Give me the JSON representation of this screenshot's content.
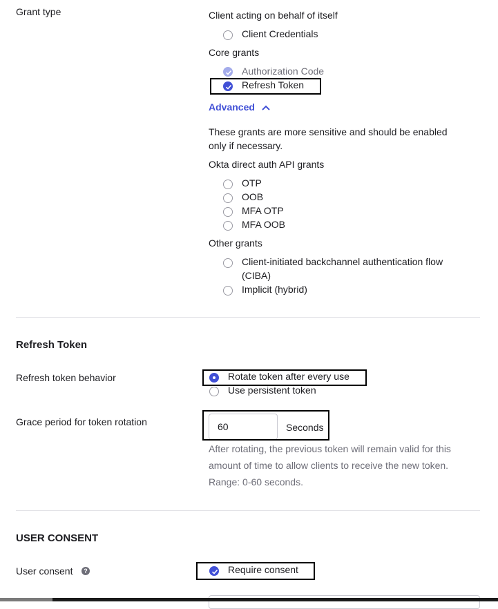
{
  "grant_type": {
    "label": "Grant type",
    "self_group": "Client acting on behalf of itself",
    "client_credentials": "Client Credentials",
    "core_group": "Core grants",
    "authorization_code": "Authorization Code",
    "refresh_token": "Refresh Token",
    "advanced_toggle": "Advanced",
    "advanced_note_line1": "These grants are more sensitive and should be enabled",
    "advanced_note_line2": "only if necessary.",
    "okta_group": "Okta direct auth API grants",
    "okta_items": [
      "OTP",
      "OOB",
      "MFA OTP",
      "MFA OOB"
    ],
    "other_group": "Other grants",
    "ciba_line1": "Client-initiated backchannel authentication flow",
    "ciba_line2": "(CIBA)",
    "implicit_hybrid": "Implicit (hybrid)"
  },
  "refresh_token_section": {
    "heading": "Refresh Token",
    "behavior_label": "Refresh token behavior",
    "rotate_option": "Rotate token after every use",
    "persistent_option": "Use persistent token",
    "grace_label": "Grace period for token rotation",
    "grace_value": "60",
    "grace_unit": "Seconds",
    "grace_help_line1": "After rotating, the previous token will remain valid for this",
    "grace_help_line2": "amount of time to allow clients to receive the new token.",
    "grace_help_line3": "Range: 0-60 seconds."
  },
  "user_consent_section": {
    "heading": "USER CONSENT",
    "label": "User consent",
    "help_glyph": "?",
    "require_consent": "Require consent"
  },
  "colors": {
    "accent": "#4150d6",
    "accent_disabled": "#a4aceb",
    "link": "#4150d6"
  }
}
